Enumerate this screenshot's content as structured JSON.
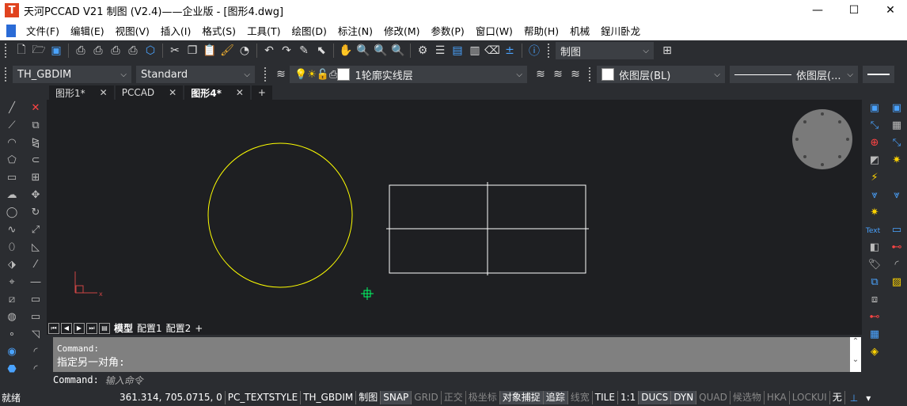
{
  "window": {
    "title": "天河PCCAD V21 制图 (V2.4)——企业版 - [图形4.dwg]",
    "logo": "T",
    "minimize": "—",
    "maximize": "☐",
    "close": "✕",
    "mdi": [
      "_",
      "▫",
      "✕"
    ]
  },
  "menu": [
    "文件(F)",
    "编辑(E)",
    "视图(V)",
    "插入(I)",
    "格式(S)",
    "工具(T)",
    "绘图(D)",
    "标注(N)",
    "修改(M)",
    "参数(P)",
    "窗口(W)",
    "帮助(H)",
    "机械",
    "鋥川卧龙"
  ],
  "toolbar1": {
    "workspace": "制图"
  },
  "toolbar2": {
    "dimstyle": "TH_GBDIM",
    "textstyle": "Standard",
    "layer": "1轮廓实线层",
    "color": "依图层(BL)",
    "linetype": "依图层(..."
  },
  "doc_tabs": [
    {
      "label": "图形1*",
      "active": false
    },
    {
      "label": "PCCAD",
      "active": false
    },
    {
      "label": "图形4*",
      "active": true
    }
  ],
  "doc_tab_close": "✕",
  "doc_tab_add": "+",
  "layout_tabs": [
    "模型",
    "配置1",
    "配置2",
    "+"
  ],
  "command": {
    "history": [
      "Command:",
      "指定另一对角:"
    ],
    "prompt": "Command:",
    "placeholder": "输入命令"
  },
  "status": {
    "ready": "就绪",
    "coords": "361.314, 705.0715, 0",
    "items": [
      {
        "label": "PC_TEXTSTYLE",
        "state": "normal"
      },
      {
        "label": "TH_GBDIM",
        "state": "normal"
      },
      {
        "label": "制图",
        "state": "normal"
      },
      {
        "label": "SNAP",
        "state": "on"
      },
      {
        "label": "GRID",
        "state": "off"
      },
      {
        "label": "正交",
        "state": "off"
      },
      {
        "label": "极坐标",
        "state": "off"
      },
      {
        "label": "对象捕捉",
        "state": "on"
      },
      {
        "label": "追踪",
        "state": "on"
      },
      {
        "label": "线宽",
        "state": "off"
      },
      {
        "label": "TILE",
        "state": "normal"
      },
      {
        "label": "1:1",
        "state": "normal"
      },
      {
        "label": "DUCS",
        "state": "on"
      },
      {
        "label": "DYN",
        "state": "on"
      },
      {
        "label": "QUAD",
        "state": "off"
      },
      {
        "label": "候选物",
        "state": "off"
      },
      {
        "label": "HKA",
        "state": "off"
      },
      {
        "label": "LOCKUI",
        "state": "off"
      },
      {
        "label": "无",
        "state": "normal"
      }
    ]
  },
  "colors": {
    "circle": "#ffff00",
    "lines": "#ffffff",
    "cursor": "#00ff66",
    "canvas": "#1e1f22",
    "command_bg": "#808080"
  },
  "right_toolbar_text": "Text"
}
